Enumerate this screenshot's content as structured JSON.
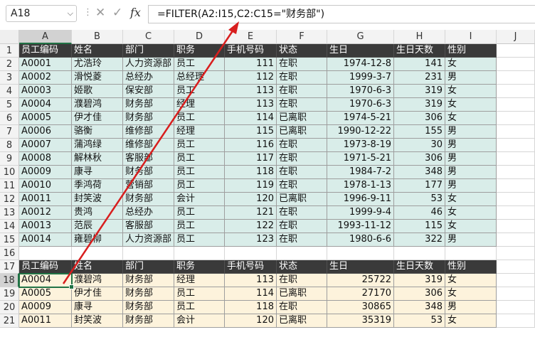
{
  "formula_bar": {
    "name_box": "A18",
    "name_box_dropdown": "chevron-down-icon",
    "separator": "⋮",
    "cancel_icon": "✕",
    "confirm_icon": "✓",
    "fx_label": "fx",
    "formula": "=FILTER(A2:I15,C2:C15=\"财务部\")"
  },
  "columns": [
    "A",
    "B",
    "C",
    "D",
    "E",
    "F",
    "G",
    "H",
    "I",
    "J"
  ],
  "selected_column": "A",
  "selected_row": 18,
  "source_header": [
    "员工编码",
    "姓名",
    "部门",
    "职务",
    "手机号码",
    "状态",
    "生日",
    "生日天数",
    "性别"
  ],
  "source_rows": [
    [
      "A0001",
      "尤浩玲",
      "人力资源部",
      "员工",
      "111",
      "在职",
      "1974-12-8",
      "141",
      "女"
    ],
    [
      "A0002",
      "滑悦菱",
      "总经办",
      "总经理",
      "112",
      "在职",
      "1999-3-7",
      "231",
      "男"
    ],
    [
      "A0003",
      "姬歌",
      "保安部",
      "员工",
      "113",
      "在职",
      "1970-6-3",
      "319",
      "女"
    ],
    [
      "A0004",
      "濮碧鸿",
      "财务部",
      "经理",
      "113",
      "在职",
      "1970-6-3",
      "319",
      "女"
    ],
    [
      "A0005",
      "伊才佳",
      "财务部",
      "员工",
      "114",
      "已离职",
      "1974-5-21",
      "306",
      "女"
    ],
    [
      "A0006",
      "骆衡",
      "维修部",
      "经理",
      "115",
      "已离职",
      "1990-12-22",
      "155",
      "男"
    ],
    [
      "A0007",
      "蒲鸿绿",
      "维修部",
      "员工",
      "116",
      "在职",
      "1973-8-19",
      "30",
      "男"
    ],
    [
      "A0008",
      "解林秋",
      "客服部",
      "员工",
      "117",
      "在职",
      "1971-5-21",
      "306",
      "男"
    ],
    [
      "A0009",
      "康寻",
      "财务部",
      "员工",
      "118",
      "在职",
      "1984-7-2",
      "348",
      "男"
    ],
    [
      "A0010",
      "季鸿荷",
      "营销部",
      "员工",
      "119",
      "在职",
      "1978-1-13",
      "177",
      "男"
    ],
    [
      "A0011",
      "封笑波",
      "财务部",
      "会计",
      "120",
      "已离职",
      "1996-9-11",
      "53",
      "女"
    ],
    [
      "A0012",
      "贵鸿",
      "总经办",
      "员工",
      "121",
      "在职",
      "1999-9-4",
      "46",
      "女"
    ],
    [
      "A0013",
      "范辰",
      "客服部",
      "员工",
      "122",
      "在职",
      "1993-11-12",
      "115",
      "女"
    ],
    [
      "A0014",
      "雍碧柳",
      "人力资源部",
      "员工",
      "123",
      "在职",
      "1980-6-6",
      "322",
      "男"
    ]
  ],
  "result_header": [
    "员工编码",
    "姓名",
    "部门",
    "职务",
    "手机号码",
    "状态",
    "生日",
    "生日天数",
    "性别"
  ],
  "result_rows": [
    [
      "A0004",
      "濮碧鸿",
      "财务部",
      "经理",
      "113",
      "在职",
      "25722",
      "319",
      "女"
    ],
    [
      "A0005",
      "伊才佳",
      "财务部",
      "员工",
      "114",
      "已离职",
      "27170",
      "306",
      "女"
    ],
    [
      "A0009",
      "康寻",
      "财务部",
      "员工",
      "118",
      "在职",
      "30865",
      "348",
      "男"
    ],
    [
      "A0011",
      "封笑波",
      "财务部",
      "会计",
      "120",
      "已离职",
      "35319",
      "53",
      "女"
    ]
  ],
  "row_numbers": [
    "1",
    "2",
    "3",
    "4",
    "5",
    "6",
    "7",
    "8",
    "9",
    "10",
    "11",
    "12",
    "13",
    "14",
    "15",
    "16",
    "17",
    "18",
    "19",
    "20",
    "21"
  ],
  "colors": {
    "header_fill": "#3a3a3a",
    "source_fill": "#d9ede9",
    "result_fill": "#fdf3dc",
    "accent": "#217346",
    "arrow": "#d81e1e"
  }
}
